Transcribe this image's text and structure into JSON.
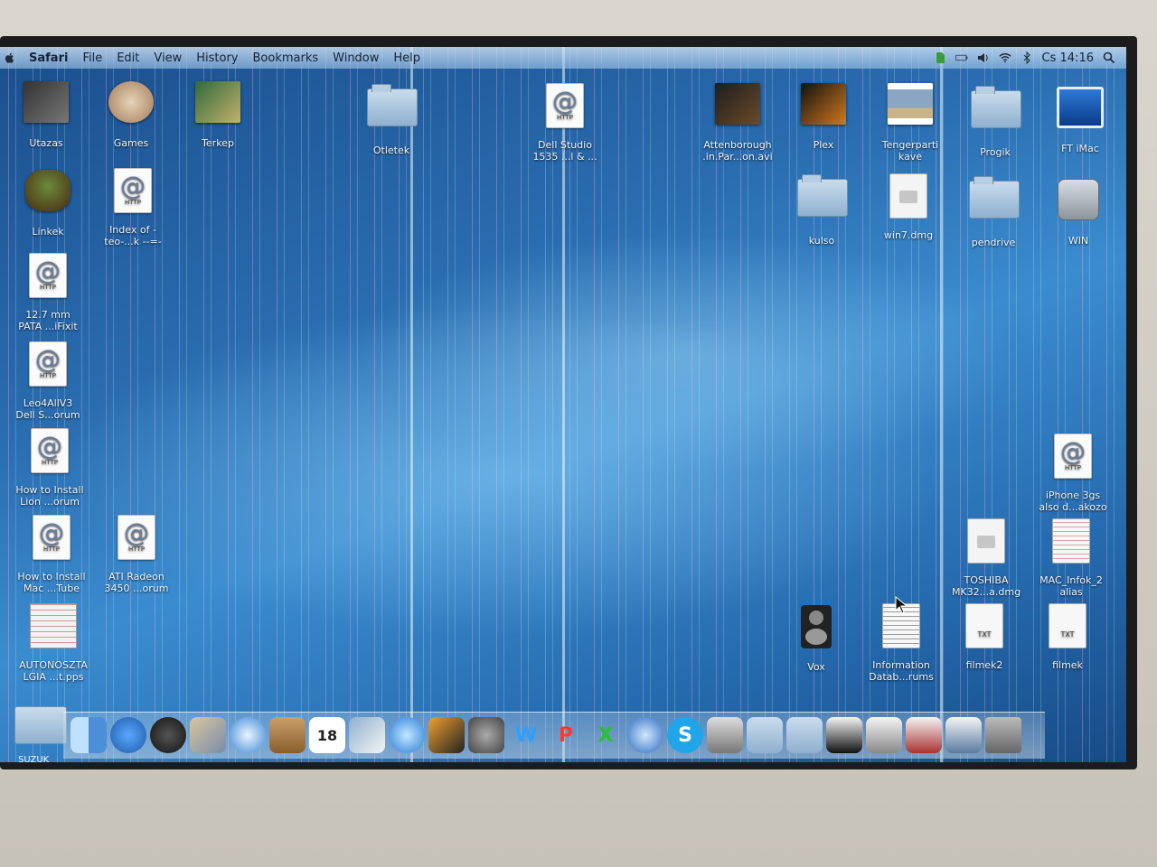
{
  "menubar": {
    "app_name": "Safari",
    "items": [
      "File",
      "Edit",
      "View",
      "History",
      "Bookmarks",
      "Window",
      "Help"
    ],
    "clock": "Cs 14:16",
    "status_icons": [
      "evernote-icon",
      "battery-icon",
      "volume-icon",
      "wifi-icon",
      "bluetooth-icon"
    ]
  },
  "desktop_icons": [
    {
      "label": "Utazas",
      "type": "thumbnail"
    },
    {
      "label": "Games",
      "type": "app"
    },
    {
      "label": "Terkep",
      "type": "app"
    },
    {
      "label": "Otletek",
      "type": "folder"
    },
    {
      "label": "Dell Studio\n1535 ...l & ...",
      "type": "webloc"
    },
    {
      "label": "Attenborough\n.in.Par...on.avi",
      "type": "video"
    },
    {
      "label": "Plex",
      "type": "app"
    },
    {
      "label": "Tengerparti\nkave",
      "type": "image"
    },
    {
      "label": "Progik",
      "type": "folder"
    },
    {
      "label": "FT iMac",
      "type": "imac"
    },
    {
      "label": "Linkek",
      "type": "app"
    },
    {
      "label": "Index of -\nteo-...k --=-",
      "type": "webloc"
    },
    {
      "label": "kulso",
      "type": "folder"
    },
    {
      "label": "win7.dmg",
      "type": "dmg"
    },
    {
      "label": "pendrive",
      "type": "folder"
    },
    {
      "label": "WIN",
      "type": "disk"
    },
    {
      "label": "12.7 mm\nPATA ...iFixit",
      "type": "webloc"
    },
    {
      "label": "Leo4AllV3\nDell S...orum",
      "type": "webloc"
    },
    {
      "label": "How to Install\nLion ...orum",
      "type": "webloc"
    },
    {
      "label": "How to Install\nMac ...Tube",
      "type": "webloc"
    },
    {
      "label": "ATI Radeon\n3450 ...orum",
      "type": "webloc"
    },
    {
      "label": "AUTONOSZTA\nLGIA ...t.pps",
      "type": "sheet"
    },
    {
      "label": "iPhone 3gs\nalso d...akozo",
      "type": "webloc"
    },
    {
      "label": "TOSHIBA\nMK32...a.dmg",
      "type": "dmg"
    },
    {
      "label": "MAC_Infok_2\nalias",
      "type": "doc"
    },
    {
      "label": "Vox",
      "type": "speaker"
    },
    {
      "label": "Information\nDatab...rums",
      "type": "doc"
    },
    {
      "label": "filmek2",
      "type": "txt"
    },
    {
      "label": "filmek",
      "type": "txt"
    }
  ],
  "doc_tags": {
    "http": "HTTP",
    "txt": "TXT"
  },
  "dock": {
    "stack_label": "SUZUK",
    "calendar_day": "18",
    "items": [
      "finder-icon",
      "app-store-icon",
      "dashboard-icon",
      "mail-icon",
      "safari-icon",
      "address-book-icon",
      "ical-icon",
      "iphoto-icon",
      "itunes-icon",
      "preview-icon",
      "system-preferences-icon",
      "word-icon",
      "powerpoint-icon",
      "excel-icon",
      "google-earth-icon",
      "skype-icon",
      "terminal-icon",
      "applications-folder-icon",
      "documents-folder-icon",
      "stack-1-icon",
      "stack-2-icon",
      "stack-3-icon",
      "stack-4-icon",
      "trash-icon"
    ],
    "letters": {
      "word": "W",
      "powerpoint": "P",
      "excel": "X",
      "skype": "S"
    }
  }
}
